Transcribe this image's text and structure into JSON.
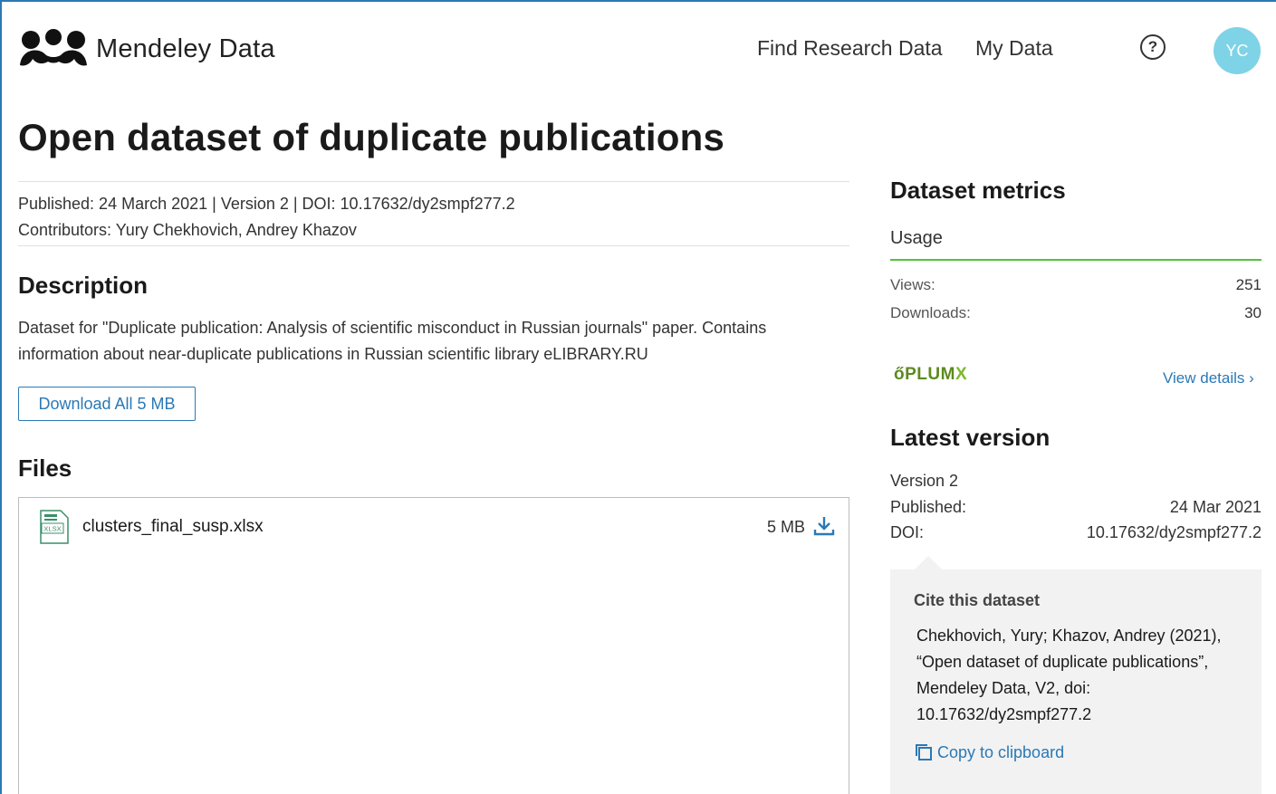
{
  "header": {
    "logo_text": "Mendeley Data",
    "nav": {
      "find": "Find Research Data",
      "my_data": "My Data"
    },
    "help_symbol": "?",
    "help_icon": "question-circle-icon",
    "avatar_initials": "YC",
    "avatar_color": "#7fd3e6"
  },
  "dataset": {
    "title": "Open dataset of duplicate publications",
    "meta_line": "Published: 24 March 2021 | Version 2 | DOI: 10.17632/dy2smpf277.2",
    "contributors_line": "Contributors:  Yury Chekhovich,  Andrey Khazov"
  },
  "description": {
    "heading": "Description",
    "text": "Dataset for \"Duplicate publication: Analysis of scientific misconduct in Russian journals\" paper. Contains information about near-duplicate publications in Russian scientific library eLIBRARY.RU",
    "download_all": "Download All 5 MB"
  },
  "files": {
    "heading": "Files",
    "items": [
      {
        "name": "clusters_final_susp.xlsx",
        "size": "5 MB",
        "icon": "xlsx-file-icon",
        "icon_label": "XLSX"
      }
    ]
  },
  "metrics": {
    "heading": "Dataset metrics",
    "tab": "Usage",
    "views_label": "Views:",
    "views_value": "251",
    "downloads_label": "Downloads:",
    "downloads_value": "30",
    "plumx_main": "PLUM",
    "plumx_x": "X",
    "view_details": "View details  ›",
    "accent_color": "#52c43a"
  },
  "latest_version": {
    "heading": "Latest version",
    "version": "Version 2",
    "published_label": "Published:",
    "published_value": "24 Mar 2021",
    "doi_label": "DOI:",
    "doi_value": "10.17632/dy2smpf277.2"
  },
  "cite": {
    "heading": "Cite this dataset",
    "line1": "Chekhovich, Yury; Khazov, Andrey (2021),",
    "line2": "“Open dataset of duplicate publications”,",
    "line3": "Mendeley Data, V2, doi:",
    "line4": "10.17632/dy2smpf277.2",
    "copy": "Copy to clipboard"
  },
  "colors": {
    "link": "#2b79b5",
    "text": "#1a1a1a"
  }
}
